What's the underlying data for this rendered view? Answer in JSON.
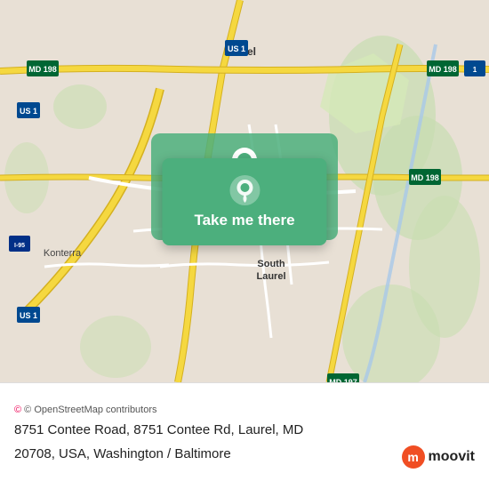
{
  "map": {
    "center": "Laurel, MD",
    "alt": "Map of 8751 Contee Road area"
  },
  "button": {
    "label": "Take me there"
  },
  "info": {
    "osm_credit": "© OpenStreetMap contributors",
    "address_line1": "8751 Contee Road, 8751 Contee Rd, Laurel, MD",
    "address_line2": "20708, USA, Washington / Baltimore"
  },
  "moovit": {
    "logo_letter": "m",
    "name": "moovit"
  }
}
